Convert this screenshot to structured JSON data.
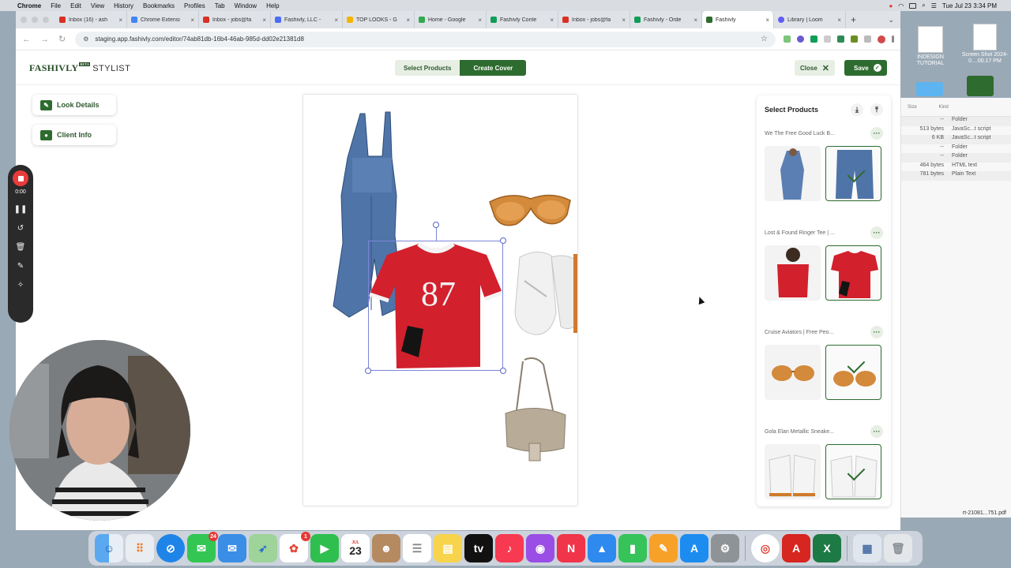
{
  "menubar": {
    "app": "Chrome",
    "items": [
      "File",
      "Edit",
      "View",
      "History",
      "Bookmarks",
      "Profiles",
      "Tab",
      "Window",
      "Help"
    ],
    "clock": "Tue Jul 23  3:34 PM"
  },
  "desktop": {
    "icons": [
      {
        "label": "INDESIGN TUTORIAL"
      },
      {
        "label": "Screen Shot 2024-0....00.17 PM"
      }
    ],
    "finder": {
      "col_size": "Size",
      "col_kind": "Kind",
      "rows": [
        {
          "size": "--",
          "kind": "Folder"
        },
        {
          "size": "513 bytes",
          "kind": "JavaSc...t script"
        },
        {
          "size": "6 KB",
          "kind": "JavaSc...t script"
        },
        {
          "size": "--",
          "kind": "Folder"
        },
        {
          "size": "--",
          "kind": "Folder"
        },
        {
          "size": "464 bytes",
          "kind": "HTML text"
        },
        {
          "size": "781 bytes",
          "kind": "Plain Text"
        }
      ],
      "footer": "rt-21081...751.pdf"
    }
  },
  "browser": {
    "tabs": [
      {
        "title": "Inbox (16) - ash",
        "color": "#d93025",
        "active": false
      },
      {
        "title": "Chrome Extensi",
        "color": "#4285f4",
        "active": false
      },
      {
        "title": "Inbox - jobs@fa",
        "color": "#d93025",
        "active": false
      },
      {
        "title": "Fashivly, LLC -",
        "color": "#4c6ef5",
        "active": false
      },
      {
        "title": "TOP LOOKS - G",
        "color": "#f4b400",
        "active": false
      },
      {
        "title": "Home - Google",
        "color": "#34a853",
        "active": false
      },
      {
        "title": "Fashivly Conte",
        "color": "#0f9d58",
        "active": false
      },
      {
        "title": "Inbox - jobs@fa",
        "color": "#d93025",
        "active": false
      },
      {
        "title": "Fashivly - Orde",
        "color": "#0f9d58",
        "active": false
      },
      {
        "title": "Fashivly",
        "color": "#2e6b2f",
        "active": true
      },
      {
        "title": "Library | Loom",
        "color": "#625df5",
        "active": false
      }
    ],
    "url": "staging.app.fashivly.com/editor/74ab81db-16b4-46ab-985d-dd02e21381d8"
  },
  "app": {
    "brand": "FASHIVLY",
    "beta": "BETA",
    "product": "STYLIST",
    "select_products_btn": "Select Products",
    "create_cover_btn": "Create Cover",
    "close_btn": "Close",
    "save_btn": "Save",
    "side": {
      "look_details": "Look Details",
      "client_info": "Client Info"
    },
    "panel": {
      "title": "Select Products",
      "groups": [
        {
          "title": "We The Free Good Luck B..."
        },
        {
          "title": "Lost & Found Ringer Tee | ..."
        },
        {
          "title": "Cruise Aviators | Free Peo..."
        },
        {
          "title": "Gola Elan Metallic Sneake..."
        }
      ]
    },
    "canvas": {
      "tee_number": "87"
    }
  },
  "loom": {
    "time": "0:00"
  },
  "dock": {
    "messages_badge": "24",
    "photos_badge": "1",
    "calendar_month": "JUL",
    "calendar_day": "23"
  }
}
